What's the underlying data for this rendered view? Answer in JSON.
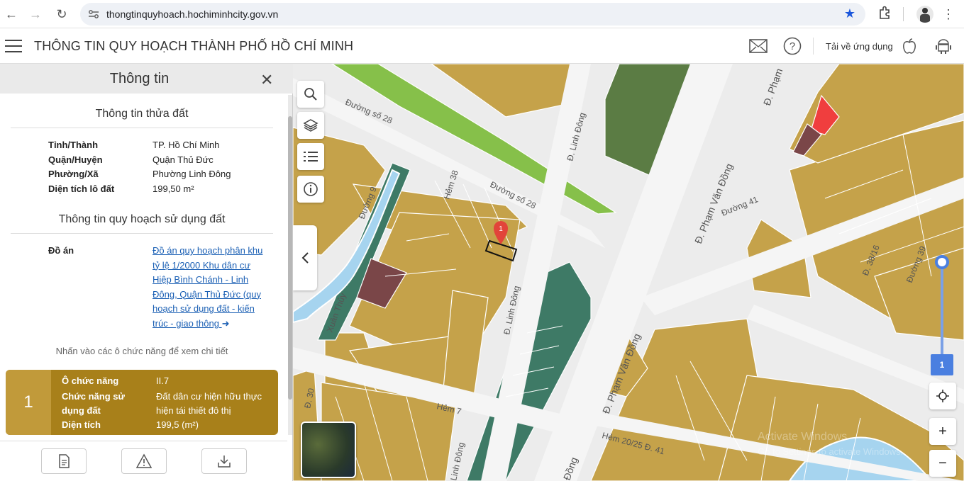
{
  "browser": {
    "url": "thongtinquyhoach.hochiminhcity.gov.vn"
  },
  "header": {
    "title": "THÔNG TIN QUY HOẠCH THÀNH PHỐ HỒ CHÍ MINH",
    "download_label": "Tải về ứng dụng"
  },
  "panel": {
    "title": "Thông tin",
    "parcel_section": "Thông tin thửa đất",
    "parcel": [
      {
        "key": "Tỉnh/Thành",
        "value": "TP. Hồ Chí Minh"
      },
      {
        "key": "Quận/Huyện",
        "value": "Quận Thủ Đức"
      },
      {
        "key": "Phường/Xã",
        "value": "Phường Linh Đông"
      },
      {
        "key": "Diện tích lô đất",
        "value": "199,50 m²"
      }
    ],
    "plan_section": "Thông tin quy hoạch sử dụng đất",
    "plan_key": "Đồ án",
    "plan_link": "Đồ án quy hoạch phân khu tỷ lệ 1/2000 Khu dân cư Hiệp Bình Chánh - Linh Đông, Quận Thủ Đức (quy hoạch sử dụng đất - kiến trúc - giao thông",
    "hint": "Nhấn vào các ô chức năng để xem chi tiết",
    "card": {
      "number": "1",
      "rows": [
        {
          "key": "Ô chức năng",
          "value": "II.7"
        },
        {
          "key": "Chức năng sử dụng đất",
          "value": "Đất dân cư hiện hữu thực hiện tái thiết đô thị"
        },
        {
          "key": "Diện tích",
          "value": "199,5 (m²)"
        }
      ]
    }
  },
  "map": {
    "marker_label": "1",
    "zoom_value": "1",
    "zoom_level_fraction": 0.1,
    "street_labels": [
      "Đường số 28",
      "Đường số 28",
      "Hẻm 38",
      "Đ. Linh Đông",
      "Đ. Linh Đông",
      "Đ. Phạm Văn Đồng",
      "Đ. Phạm Văn Đồng",
      "Đường 41",
      "Đường 39",
      "Hẻm 7",
      "Hẻm 20/25 Đ. 41",
      "Đ. Phạm",
      "Đ. 30",
      "Linh Đông",
      "Đường 9",
      "Đ. 38/16",
      "Xuân Thủy",
      "Đồng"
    ],
    "watermark_1": "Activate Windows",
    "watermark_2": "Go to Settings to activate Windows.",
    "colors": {
      "residential": "#c5a24a",
      "green": "#86c04a",
      "teal": "#3e7a66",
      "dark_green": "#5b7c44",
      "maroon": "#7a4648",
      "red": "#f03e3e",
      "water": "#a6d4ef",
      "road": "#f5f5f5",
      "marker": "#e2443a"
    }
  }
}
